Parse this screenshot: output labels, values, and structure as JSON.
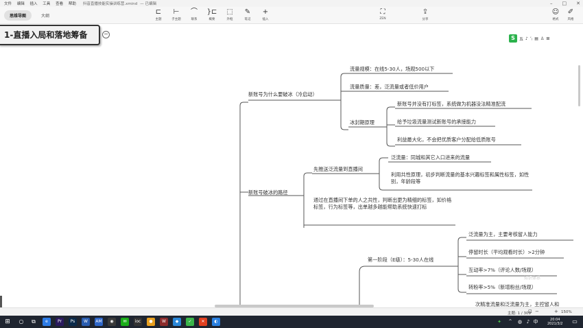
{
  "titlebar": {
    "menu": [
      "文件",
      "编辑",
      "插入",
      "工具",
      "查看",
      "帮助"
    ],
    "filename": "抖音直播技能实操训练营.xmind",
    "edition": "已编辑"
  },
  "toolbar": {
    "view_tabs": [
      "思维导图",
      "大纲"
    ],
    "buttons": {
      "topic": "主题",
      "subtopic": "子主题",
      "relation": "联系",
      "summary": "概要",
      "boundary": "外框",
      "note": "笔记",
      "insert": "插入",
      "zen": "ZEN",
      "share": "分享",
      "format": "格式",
      "style": "风格"
    }
  },
  "mindmap": {
    "root": "1-直播入局和落地筹备",
    "collapse_symbol": "−",
    "branch1": {
      "label": "新账号为什么要破冰（冷启动）",
      "children": [
        "流量规模：在线5-30人，场观500以下",
        "流量质量：差，泛流量或者低价用户",
        "冰封期原理"
      ],
      "ice_children": [
        "新账号并没有打标签，系统做为机器没法精准配流",
        "给予垃圾流量测试新账号的承接能力",
        "利益最大化，不会把优质客户分配给低质账号"
      ]
    },
    "branch2": {
      "label": "新账号破冰的路径",
      "push": "先推送泛流量到直播间",
      "push_children": [
        "泛流量：同城和其它入口进来的流量",
        "利用共性原理，初步判断流量的基本兴趣标签和属性标签，如性别，年龄段等"
      ],
      "tagging": "通过在直播间下单的人之共性，判断出更为精细的标签，如价格标签，行为标签等，出单越多越能帮助系统快速打标",
      "stage1": "第一阶段（E级）：5-30人在线",
      "stage1_children": [
        "泛流量为主，主要考核留人能力",
        "停留时长（平均观看时长）>2分钟",
        "互动率>7%（评论人数/场观）",
        "转粉率>5%（新增粉丝/场观）"
      ],
      "cut_text": "次精准流量和泛流量为主，主控留人和"
    }
  },
  "quickbar": {
    "logo": "S",
    "items": [
      "五",
      "♪",
      "ʼ₎",
      "▤",
      "♙",
      "⊞"
    ]
  },
  "watermark": "知识体系",
  "status": {
    "topic_count": "主题: 1 / 309",
    "zoom": "150%"
  },
  "taskbar": {
    "apps": [
      {
        "label": "e",
        "color": "#2d7be5"
      },
      {
        "label": "Pr",
        "color": "#2a1a5e"
      },
      {
        "label": "Ps",
        "color": "#0b2a4a"
      },
      {
        "label": "W",
        "color": "#2a5db0"
      },
      {
        "label": "AM",
        "color": "#2e66c8"
      },
      {
        "label": "◉",
        "color": "#3a3a3a"
      },
      {
        "label": "✉",
        "color": "#1aad19"
      },
      {
        "label": "ioc",
        "color": "#333"
      },
      {
        "label": "●",
        "color": "#e8a020"
      },
      {
        "label": "W",
        "color": "#8b2b2b"
      },
      {
        "label": "◆",
        "color": "#2a87d8"
      },
      {
        "label": "✓",
        "color": "#3bb54a"
      },
      {
        "label": "✕",
        "color": "#e04020"
      },
      {
        "label": "◐",
        "color": "#2a80e0"
      }
    ],
    "time": "20:04",
    "date": "2021/3/2",
    "lang": "中"
  }
}
